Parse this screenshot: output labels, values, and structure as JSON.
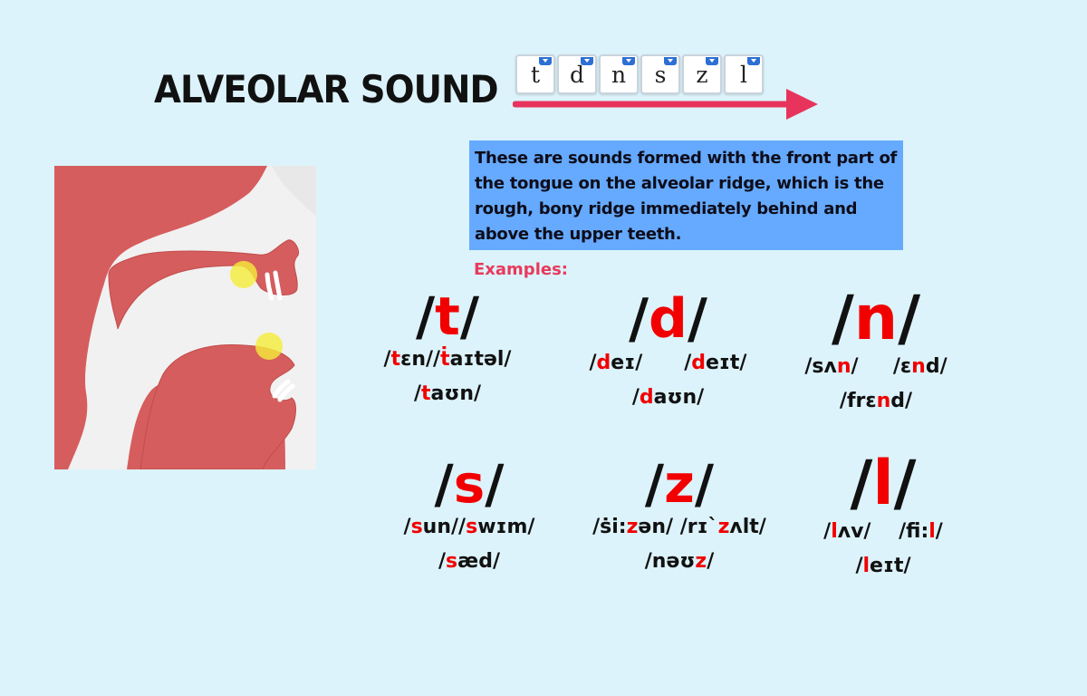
{
  "title": "ALVEOLAR SOUND",
  "tiles": [
    "t",
    "d",
    "n",
    "s",
    "z",
    "l"
  ],
  "description": "These are sounds formed with the front part of the tongue on the alveolar ridge, which is the rough, bony ridge immediately behind and above the upper teeth.",
  "examples_label": "Examples:",
  "colors": {
    "background": "#dcf3fb",
    "accent_red": "#f20000",
    "arrow": "#e8345c",
    "desc_box": "#66aaff",
    "tile_corner": "#2d6fd4"
  },
  "sounds": [
    {
      "pre": "/",
      "sym": "t",
      "post": "/",
      "l1": [
        {
          "t": "/"
        },
        {
          "t": "t",
          "r": 1
        },
        {
          "t": "ɛn//"
        },
        {
          "t": "ṫ",
          "r": 1
        },
        {
          "t": "aɪtəl/"
        }
      ],
      "l2": [
        {
          "t": "/"
        },
        {
          "t": "t",
          "r": 1
        },
        {
          "t": "aʊn/"
        }
      ]
    },
    {
      "pre": "/",
      "sym": "d",
      "post": "/",
      "l1": [
        {
          "t": "/"
        },
        {
          "t": "d",
          "r": 1
        },
        {
          "t": "eɪ/      /"
        },
        {
          "t": "d",
          "r": 1
        },
        {
          "t": "eɪt/"
        }
      ],
      "l2": [
        {
          "t": "/"
        },
        {
          "t": "d",
          "r": 1
        },
        {
          "t": "aʊn/"
        }
      ]
    },
    {
      "pre": "/",
      "sym": "n",
      "post": "/",
      "l1": [
        {
          "t": "/sʌ"
        },
        {
          "t": "n",
          "r": 1
        },
        {
          "t": "/     /ɛ"
        },
        {
          "t": "n",
          "r": 1
        },
        {
          "t": "d/"
        }
      ],
      "l2": [
        {
          "t": "/frɛ"
        },
        {
          "t": "n",
          "r": 1
        },
        {
          "t": "d/"
        }
      ]
    },
    {
      "pre": "/",
      "sym": "s",
      "post": "/",
      "l1": [
        {
          "t": "/"
        },
        {
          "t": "s",
          "r": 1
        },
        {
          "t": "un//"
        },
        {
          "t": "s",
          "r": 1
        },
        {
          "t": "wɪm/"
        }
      ],
      "l2": [
        {
          "t": "/"
        },
        {
          "t": "s",
          "r": 1
        },
        {
          "t": "æd/"
        }
      ]
    },
    {
      "pre": "/",
      "sym": "z",
      "post": "/",
      "l1": [
        {
          "t": "/ṡi:"
        },
        {
          "t": "z",
          "r": 1
        },
        {
          "t": "ən/ /rɪ`"
        },
        {
          "t": "z",
          "r": 1
        },
        {
          "t": "ʌlt/"
        }
      ],
      "l2": [
        {
          "t": "/nəʊ"
        },
        {
          "t": "z",
          "r": 1
        },
        {
          "t": "/"
        }
      ]
    },
    {
      "pre": "/",
      "sym": "l",
      "post": "/",
      "l1": [
        {
          "t": "/"
        },
        {
          "t": "l",
          "r": 1
        },
        {
          "t": "ʌv/    /fi:"
        },
        {
          "t": "l",
          "r": 1
        },
        {
          "t": "/"
        }
      ],
      "l2": [
        {
          "t": "/"
        },
        {
          "t": "l",
          "r": 1
        },
        {
          "t": "eɪt/"
        }
      ]
    }
  ]
}
